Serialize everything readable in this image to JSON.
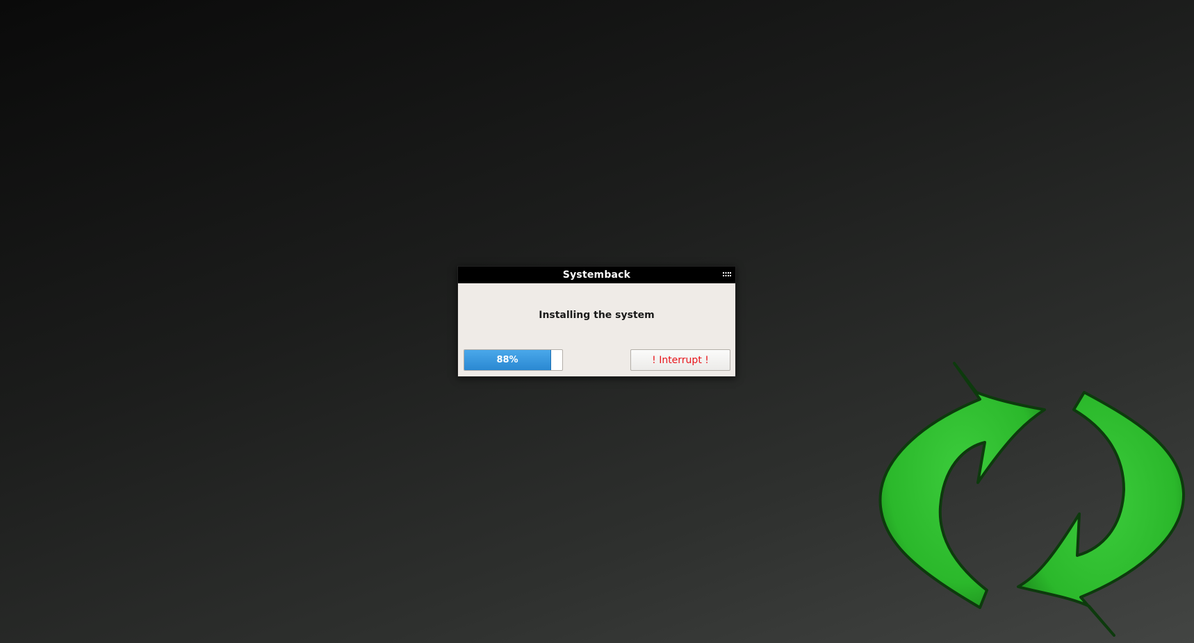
{
  "window": {
    "title": "Systemback"
  },
  "dialog": {
    "message": "Installing the system"
  },
  "progress": {
    "value": 88,
    "label": "88%",
    "fill_color": "#2e8fd8"
  },
  "buttons": {
    "interrupt_label": "! Interrupt !",
    "interrupt_color": "#e8141a"
  },
  "icons": {
    "titlebar_menu": "grip-icon",
    "logo": "systemback-refresh-logo"
  },
  "colors": {
    "logo_green": "#2dba2d",
    "titlebar": "#000000",
    "dialog_bg": "#efebe7"
  }
}
